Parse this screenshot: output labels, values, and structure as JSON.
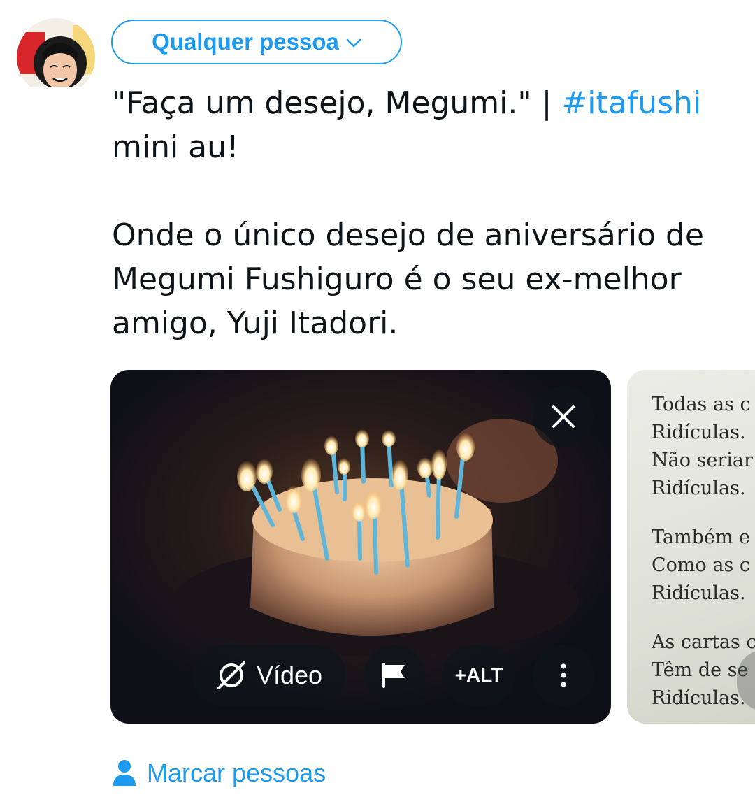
{
  "composer": {
    "audience_label": "Qualquer pessoa",
    "text": {
      "line1_prefix": " \"Faça um desejo, Megumi.\" | ",
      "hashtag": "#itafushi",
      "line2": "mini au!",
      "line3": "Onde o único desejo de aniversário de",
      "line4": "Megumi Fushiguro é o seu ex-melhor",
      "line5": "amigo, Yuji Itadori."
    }
  },
  "media": {
    "video_label": "Vídeo",
    "alt_label": "+ALT",
    "second_image_lines": [
      [
        "Todas as c",
        "Ridículas.",
        "Não seriar",
        "Ridículas."
      ],
      [
        "Também e",
        "Como as c",
        "Ridículas."
      ],
      [
        "As cartas c",
        "Têm de se",
        "Ridículas."
      ]
    ]
  },
  "footer": {
    "tag_people_label": "Marcar pessoas"
  },
  "colors": {
    "accent": "#1d9bf0",
    "text": "#0f1419",
    "overlay": "rgba(15,20,25,0.75)"
  },
  "icons": [
    "avatar",
    "chevron-down-icon",
    "close-icon",
    "video-edit-icon",
    "flag-icon",
    "more-vertical-icon",
    "person-icon"
  ]
}
